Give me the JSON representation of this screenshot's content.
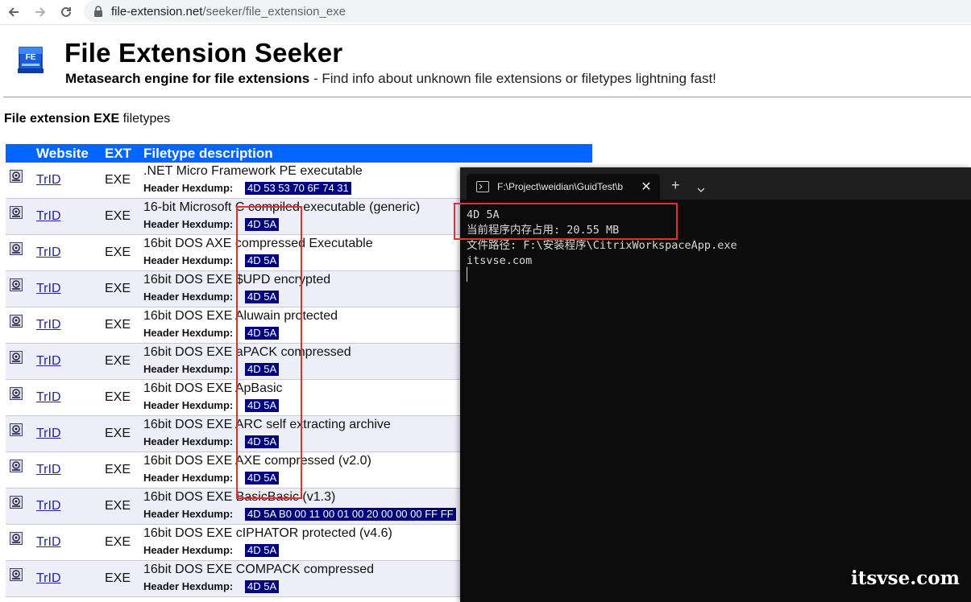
{
  "browser": {
    "url_host": "file-extension.net",
    "url_path": "/seeker/file_extension_exe"
  },
  "site": {
    "logo_text": "FE",
    "title": "File Extension Seeker",
    "subtitle_bold": "Metasearch engine for file extensions",
    "subtitle_rest": " - Find info about unknown file extensions or filetypes lightning fast!"
  },
  "section": {
    "title_bold": "File extension EXE",
    "title_rest": " filetypes"
  },
  "table": {
    "headers": {
      "website": "Website",
      "ext": "EXT",
      "desc": "Filetype description"
    },
    "hex_label": "Header Hexdump:",
    "rows": [
      {
        "website": "TrID",
        "ext": "EXE",
        "desc": ".NET Micro Framework PE executable",
        "hex": "4D 53 53 70 6F 74 31"
      },
      {
        "website": "TrID",
        "ext": "EXE",
        "desc": "16-bit Microsoft C compiled executable (generic)",
        "hex": "4D 5A"
      },
      {
        "website": "TrID",
        "ext": "EXE",
        "desc": "16bit DOS AXE compressed Executable",
        "hex": "4D 5A"
      },
      {
        "website": "TrID",
        "ext": "EXE",
        "desc": "16bit DOS EXE $UPD encrypted",
        "hex": "4D 5A"
      },
      {
        "website": "TrID",
        "ext": "EXE",
        "desc": "16bit DOS EXE Aluwain protected",
        "hex": "4D 5A"
      },
      {
        "website": "TrID",
        "ext": "EXE",
        "desc": "16bit DOS EXE aPACK compressed",
        "hex": "4D 5A"
      },
      {
        "website": "TrID",
        "ext": "EXE",
        "desc": "16bit DOS EXE ApBasic",
        "hex": "4D 5A"
      },
      {
        "website": "TrID",
        "ext": "EXE",
        "desc": "16bit DOS EXE ARC self extracting archive",
        "hex": "4D 5A"
      },
      {
        "website": "TrID",
        "ext": "EXE",
        "desc": "16bit DOS EXE AXE compressed (v2.0)",
        "hex": "4D 5A"
      },
      {
        "website": "TrID",
        "ext": "EXE",
        "desc": "16bit DOS EXE BasicBasic (v1.3)",
        "hex": "4D 5A B0 00 11 00 01 00 20 00 00 00 FF FF"
      },
      {
        "website": "TrID",
        "ext": "EXE",
        "desc": "16bit DOS EXE cIPHATOR protected (v4.6)",
        "hex": "4D 5A"
      },
      {
        "website": "TrID",
        "ext": "EXE",
        "desc": "16bit DOS EXE COMPACK compressed",
        "hex": "4D 5A"
      }
    ]
  },
  "terminal": {
    "tab_title": "F:\\Project\\weidian\\GuidTest\\b",
    "tab_close": "✕",
    "new_tab": "+",
    "lines": [
      "4D 5A",
      "当前程序内存占用: 20.55 MB",
      "文件路径: F:\\安装程序\\CitrixWorkspaceApp.exe",
      "itsvse.com"
    ]
  },
  "watermark": "itsvse.com",
  "colors": {
    "table_header": "#0066ff",
    "hex_bg": "#000080",
    "highlight_box": "#e03030",
    "terminal_bg": "#0c0c0c"
  }
}
